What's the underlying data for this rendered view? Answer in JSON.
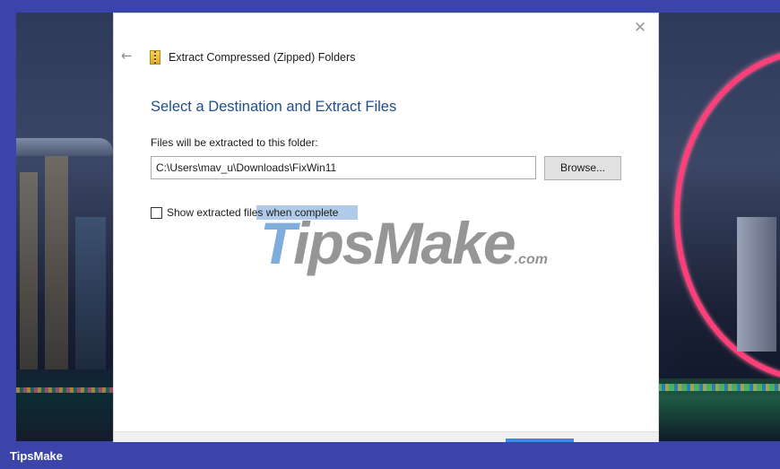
{
  "dialog": {
    "title": "Extract Compressed (Zipped) Folders",
    "heading": "Select a Destination and Extract Files",
    "destination_label": "Files will be extracted to this folder:",
    "destination_value": "C:\\Users\\mav_u\\Downloads\\FixWin11",
    "browse_label": "Browse...",
    "show_files_label": "Show extracted files when complete",
    "show_files_checked": false,
    "close_glyph": "✕",
    "back_glyph": "←"
  },
  "watermark": {
    "brand_first": "T",
    "brand_rest": "ipsMake",
    "brand_suffix": ".com"
  },
  "caption": {
    "text": "TipsMake"
  },
  "colors": {
    "heading": "#1f4e8c",
    "frame": "#3b44a8",
    "highlight": "#6ea0d7"
  },
  "icons": {
    "title_icon": "zip-folder-icon",
    "close_icon": "close-icon",
    "back_icon": "back-arrow-icon"
  }
}
